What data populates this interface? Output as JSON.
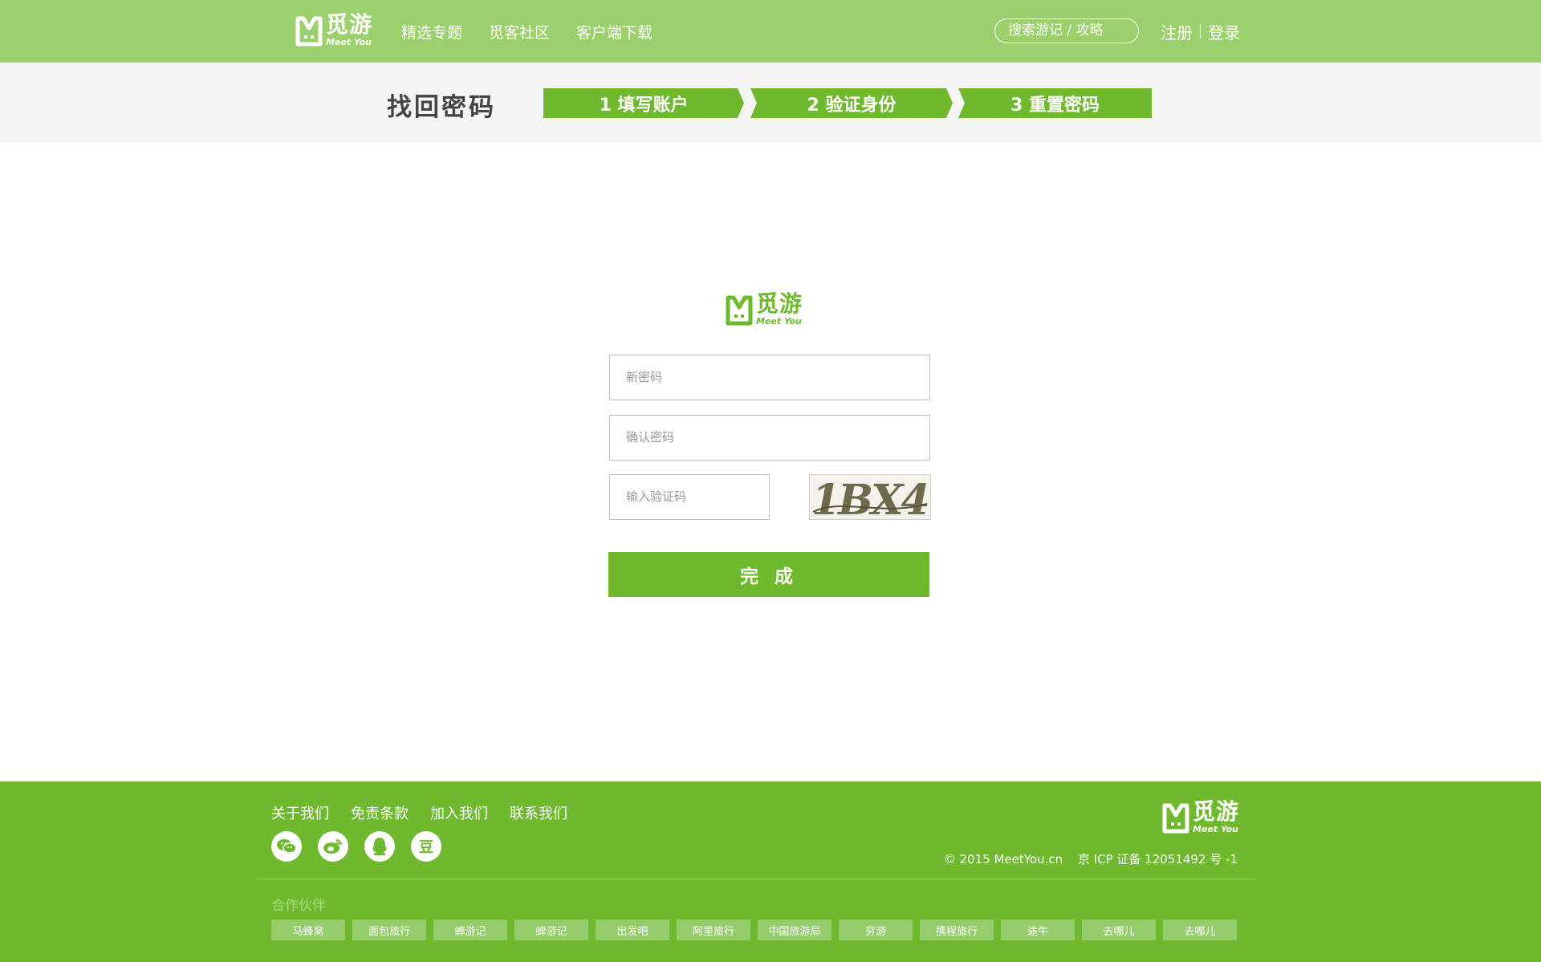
{
  "header": {
    "logo_cn": "觅游",
    "logo_en": "Meet You",
    "nav": [
      "精选专题",
      "觅客社区",
      "客户端下载"
    ],
    "search_placeholder": "搜索游记 / 攻略",
    "register": "注册",
    "login": "登录"
  },
  "steps": {
    "title": "找回密码",
    "items": [
      "1 填写账户",
      "2 验证身份",
      "3 重置密码"
    ]
  },
  "form": {
    "logo_cn": "觅游",
    "logo_en": "Meet You",
    "new_password_placeholder": "新密码",
    "confirm_password_placeholder": "确认密码",
    "captcha_placeholder": "输入验证码",
    "captcha_text": "1BX4",
    "submit": "完 成"
  },
  "footer": {
    "links": [
      "关于我们",
      "免责条款",
      "加入我们",
      "联系我们"
    ],
    "social_icons": [
      "wechat-icon",
      "weibo-icon",
      "qq-icon",
      "douban-icon"
    ],
    "douban_glyph": "豆",
    "logo_cn": "觅游",
    "logo_en": "Meet You",
    "copyright": "© 2015 MeetYou.cn",
    "icp": "京 ICP 证备 12051492 号 -1",
    "partners_title": "合作伙伴",
    "partners": [
      "马蜂窝",
      "面包旅行",
      "蝉游记",
      "蝉游记",
      "出发吧",
      "阿里旅行",
      "中国旅游局",
      "穷游",
      "携程旅行",
      "途牛",
      "去哪儿",
      "去哪儿"
    ]
  },
  "colors": {
    "header_green": "#9bd06c",
    "brand_green": "#6fb92e",
    "band_gray": "#f5f5f5"
  }
}
